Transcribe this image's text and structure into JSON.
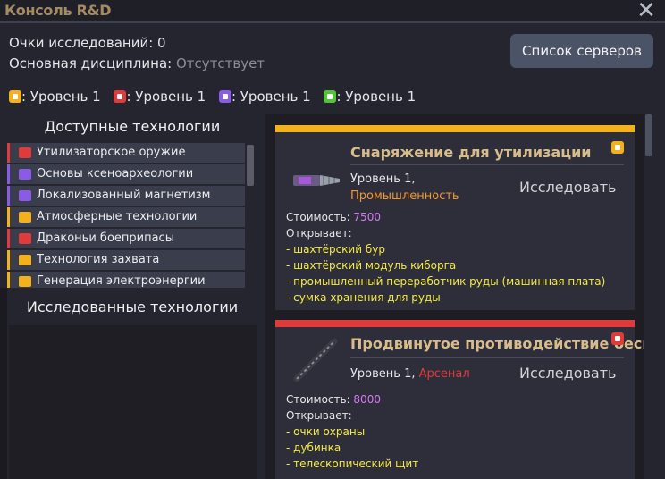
{
  "window": {
    "title": "Консоль R&D",
    "close_symbol": "✕"
  },
  "info": {
    "points_label": "Очки исследований: ",
    "points_value": "0",
    "discipline_label": "Основная дисциплина: ",
    "discipline_value": "Отсутствует"
  },
  "server_button": "Список серверов",
  "levels": [
    {
      "text": ": Уровень 1",
      "color": "#f3b21b",
      "icon": "industry-icon"
    },
    {
      "text": ": Уровень 1",
      "color": "#e03a3a",
      "icon": "arsenal-icon"
    },
    {
      "text": ": Уровень 1",
      "color": "#8a5ce6",
      "icon": "experimental-icon"
    },
    {
      "text": ": Уровень 1",
      "color": "#56c23a",
      "icon": "biochem-icon"
    }
  ],
  "available": {
    "title": "Доступные технологии",
    "items": [
      {
        "label": "Утилизаторское оружие",
        "color": "#e03a3a"
      },
      {
        "label": "Основы ксеноархеологии",
        "color": "#8a5ce6"
      },
      {
        "label": "Локализованный магнетизм",
        "color": "#8a5ce6"
      },
      {
        "label": "Атмосферные технологии",
        "color": "#f3b21b"
      },
      {
        "label": "Драконьи боеприпасы",
        "color": "#e03a3a"
      },
      {
        "label": "Технология захвата",
        "color": "#f3b21b"
      },
      {
        "label": "Генерация электроэнергии",
        "color": "#f3b21b"
      }
    ]
  },
  "researched": {
    "title": "Исследованные технологии"
  },
  "cards": [
    {
      "name": "Снаряжение для утилизации",
      "level": "Уровень 1,",
      "discipline": "Промышленность",
      "discipline_color": "#f3962b",
      "bar_color": "#f3b21b",
      "button": "Исследовать",
      "cost_label": "Стоимость: ",
      "cost_value": "7500",
      "unlocks_label": "Открывает:",
      "unlocks": [
        "- шахтёрский бур",
        "- шахтёрский модуль киборга",
        "- промышленный переработчик руды (машинная плата)",
        "- сумка хранения для руды"
      ]
    },
    {
      "name": "Продвинутое противодействие беспорядкам",
      "level": "Уровень 1,",
      "discipline": "Арсенал",
      "discipline_color": "#e03a3a",
      "bar_color": "#e03a3a",
      "button": "Исследовать",
      "cost_label": "Стоимость: ",
      "cost_value": "8000",
      "unlocks_label": "Открывает:",
      "unlocks": [
        "- очки охраны",
        "- дубинка",
        "- телескопический щит"
      ]
    }
  ]
}
